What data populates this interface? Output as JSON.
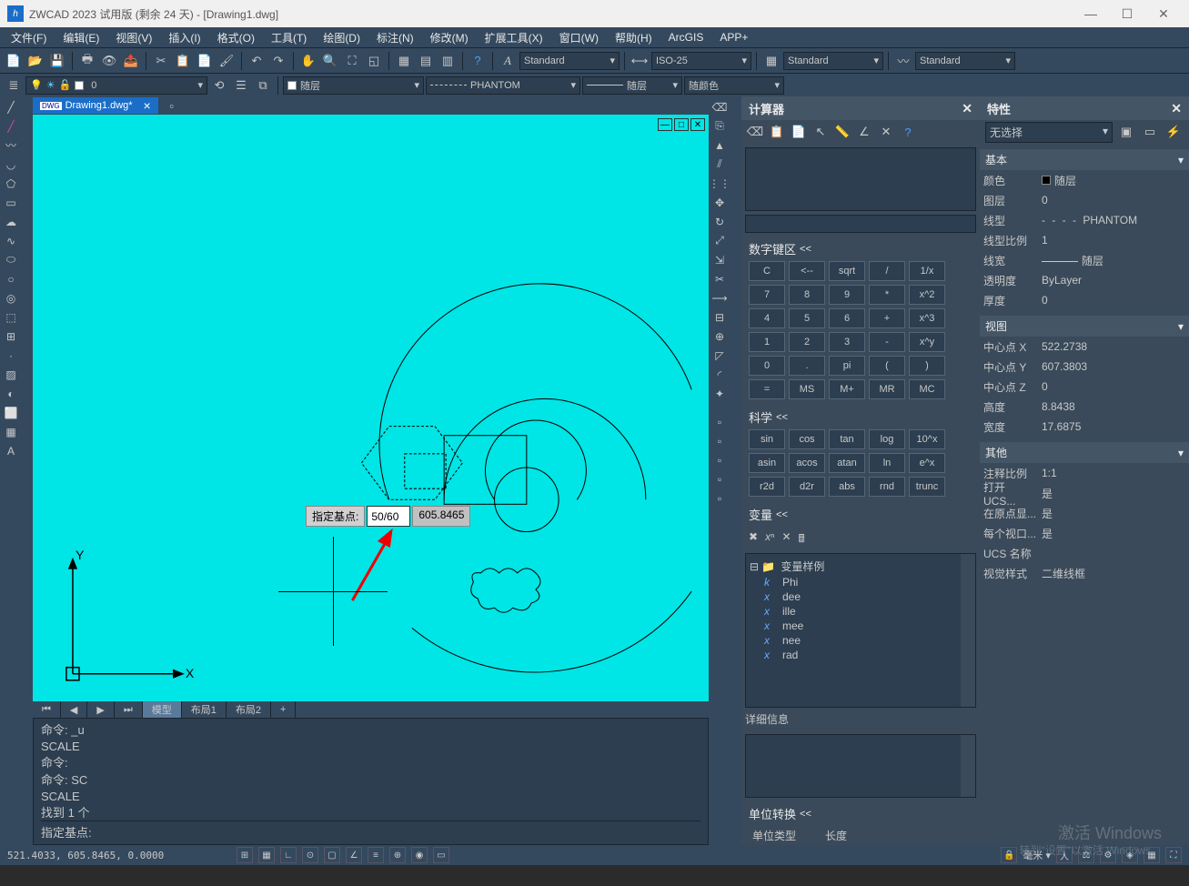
{
  "title": "ZWCAD 2023 试用版 (剩余 24 天) - [Drawing1.dwg]",
  "menu": [
    "文件(F)",
    "编辑(E)",
    "视图(V)",
    "插入(I)",
    "格式(O)",
    "工具(T)",
    "绘图(D)",
    "标注(N)",
    "修改(M)",
    "扩展工具(X)",
    "窗口(W)",
    "帮助(H)",
    "ArcGIS",
    "APP+"
  ],
  "styleCombos": {
    "text": "Standard",
    "dim": "ISO-25",
    "tbl": "Standard",
    "ml": "Standard"
  },
  "layer": {
    "name": "0"
  },
  "layerProps": {
    "linetype": "随层",
    "linetype2": "PHANTOM",
    "lineweight": "随层",
    "color": "随颜色"
  },
  "fileTab": "Drawing1.dwg*",
  "prompt": {
    "label": "指定基点:",
    "input": "50/60",
    "coord": "605.8465"
  },
  "bottomTabs": {
    "model": "模型",
    "l1": "布局1",
    "l2": "布局2",
    "plus": "+"
  },
  "cmd": {
    "l1": "命令: _u",
    "l2": "SCALE",
    "l3": "命令:",
    "l4": "命令: SC",
    "l5": "SCALE",
    "l6": "找到 1 个",
    "prompt": "指定基点:"
  },
  "status": {
    "coords": "521.4033, 605.8465, 0.0000"
  },
  "calc": {
    "title": "计算器",
    "numSection": "数字键区",
    "keys": [
      [
        "C",
        "<--",
        "sqrt",
        "/",
        "1/x"
      ],
      [
        "7",
        "8",
        "9",
        "*",
        "x^2"
      ],
      [
        "4",
        "5",
        "6",
        "+",
        "x^3"
      ],
      [
        "1",
        "2",
        "3",
        "-",
        "x^y"
      ],
      [
        "0",
        ".",
        "pi",
        "(",
        ")"
      ],
      [
        "=",
        "MS",
        "M+",
        "MR",
        "MC"
      ]
    ],
    "sciSection": "科学",
    "sciKeys": [
      [
        "sin",
        "cos",
        "tan",
        "log",
        "10^x"
      ],
      [
        "asin",
        "acos",
        "atan",
        "ln",
        "e^x"
      ],
      [
        "r2d",
        "d2r",
        "abs",
        "rnd",
        "trunc"
      ]
    ],
    "varSection": "变量",
    "varRoot": "变量样例",
    "vars": [
      "Phi",
      "dee",
      "ille",
      "mee",
      "nee",
      "rad"
    ],
    "detailSection": "详细信息",
    "unitSection": "单位转换",
    "unitType": "单位类型",
    "unitTypeVal": "长度"
  },
  "props": {
    "title": "特性",
    "noSel": "无选择",
    "basic": "基本",
    "basicRows": {
      "color": "颜色",
      "colorV": "随层",
      "layer": "图层",
      "layerV": "0",
      "ltype": "线型",
      "ltypeV": "PHANTOM",
      "ltscale": "线型比例",
      "ltscaleV": "1",
      "lweight": "线宽",
      "lweightV": "随层",
      "trans": "透明度",
      "transV": "ByLayer",
      "thick": "厚度",
      "thickV": "0"
    },
    "view": "视图",
    "viewRows": {
      "cx": "中心点 X",
      "cxV": "522.2738",
      "cy": "中心点 Y",
      "cyV": "607.3803",
      "cz": "中心点 Z",
      "czV": "0",
      "h": "高度",
      "hV": "8.8438",
      "w": "宽度",
      "wV": "17.6875"
    },
    "other": "其他",
    "otherRows": {
      "ann": "注释比例",
      "annV": "1:1",
      "ucs1": "打开 UCS...",
      "ucs1V": "是",
      "ucs2": "在原点显...",
      "ucs2V": "是",
      "ucs3": "每个视口...",
      "ucs3V": "是",
      "ucsn": "UCS 名称",
      "ucsnV": "",
      "vs": "视觉样式",
      "vsV": "二维线框"
    }
  },
  "watermark": {
    "l1": "激活 Windows",
    "l2": "转到\"设置\"以激活 Windows。"
  }
}
